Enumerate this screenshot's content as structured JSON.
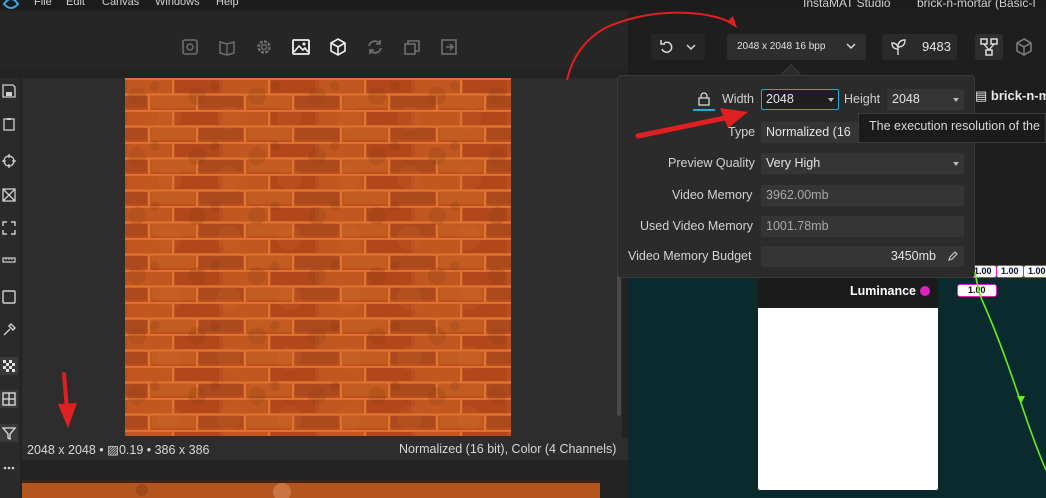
{
  "menu": {
    "items": [
      "File",
      "Edit",
      "Canvas",
      "Windows",
      "Help"
    ],
    "app_title": "InstaMAT Studio",
    "file_title": "brick-n-mortar (Basic-I"
  },
  "viewport_toolbar": {
    "icons": [
      "gallery-icon",
      "book-icon",
      "gear-icon",
      "image-icon",
      "cube-icon",
      "refresh-icon",
      "layers-icon",
      "export-icon"
    ]
  },
  "left_rail": {
    "icons": [
      "save-icon",
      "clipboard-icon",
      "crosshair-icon",
      "grid-icon",
      "fit-icon",
      "ruler-icon",
      "square-icon",
      "eyedropper-icon",
      "checker-icon",
      "tiles-icon",
      "filter-icon",
      "more-icon"
    ]
  },
  "status": {
    "left": "2048 x 2048 • ▨0.19 • 386 x 386",
    "right": "Normalized (16 bit), Color (4 Channels)"
  },
  "right_toolbar": {
    "resolution_label": "2048 x 2048 16 bpp",
    "sprout_value": "9483"
  },
  "popover": {
    "width_label": "Width",
    "width_value": "2048",
    "height_label": "Height",
    "height_value": "2048",
    "type_label": "Type",
    "type_value": "Normalized (16",
    "preview_quality_label": "Preview Quality",
    "preview_quality_value": "Very High",
    "video_memory_label": "Video Memory",
    "video_memory_value": "3962.00mb",
    "used_video_memory_label": "Used Video Memory",
    "used_video_memory_value": "1001.78mb",
    "budget_label": "Video Memory Budget",
    "budget_value": "3450mb"
  },
  "tooltip": {
    "text": "The execution resolution of the"
  },
  "graph": {
    "node_name": "brick-n-m",
    "node_title": "Luminance",
    "chips": [
      "1.00",
      "1.00",
      "1.00",
      "1.00"
    ]
  },
  "colors": {
    "accent": "#2aa7d6",
    "pin": "#e020c0",
    "wire": "#66ee22",
    "annotation": "#e02020",
    "brick": "#b84e1e",
    "graph_bg": "#0a2a2e"
  }
}
